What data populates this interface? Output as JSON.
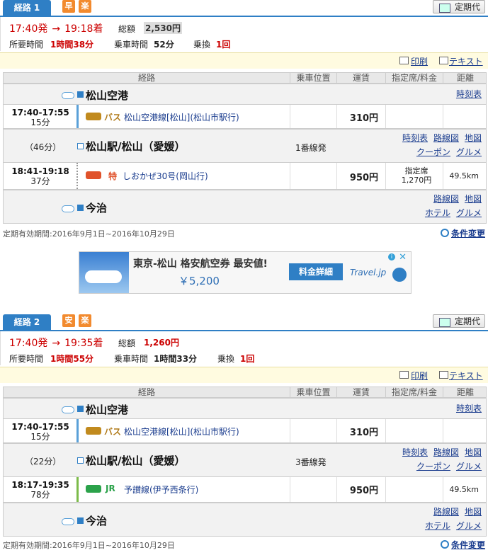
{
  "routes": [
    {
      "tab": "経路 1",
      "badges": [
        "早",
        "楽"
      ],
      "teiki": "定期代",
      "dep": "17:40発",
      "arr": "19:18着",
      "total_label": "総額",
      "total": "2,530円",
      "req_label": "所要時間",
      "req": "1時間38分",
      "ride_label": "乗車時間",
      "ride": "52分",
      "xfer_label": "乗換",
      "xfer": "1回",
      "print": "印刷",
      "text": "テキスト",
      "headers": [
        "経路",
        "乗車位置",
        "運賃",
        "指定席/料金",
        "距離"
      ],
      "stations": [
        {
          "name": "松山空港",
          "links": [
            "時刻表"
          ]
        },
        {
          "name": "松山駅/松山（愛媛）",
          "wait": "（46分）",
          "platform": "1番線発",
          "links": [
            "時刻表",
            "路線図",
            "地図",
            "クーポン",
            "グルメ"
          ]
        },
        {
          "name": "今治",
          "links": [
            "路線図",
            "地図",
            "ホテル",
            "グルメ"
          ]
        }
      ],
      "segments": [
        {
          "time": "17:40-17:55",
          "dur": "15分",
          "mode": "バス",
          "line": "松山空港線[松山](松山市駅行)",
          "fare": "310円",
          "resv": "",
          "resv2": "",
          "dist": ""
        },
        {
          "time": "18:41-19:18",
          "dur": "37分",
          "mode": "特",
          "line": "しおかぜ30号(岡山行)",
          "fare": "950円",
          "resv": "指定席",
          "resv2": "1,270円",
          "dist": "49.5km"
        }
      ],
      "validity": "定期有効期間:2016年9月1日~2016年10月29日",
      "cond": "条件変更"
    },
    {
      "tab": "経路 2",
      "badges": [
        "安",
        "楽"
      ],
      "teiki": "定期代",
      "dep": "17:40発",
      "arr": "19:35着",
      "total_label": "総額",
      "total": "1,260円",
      "req_label": "所要時間",
      "req": "1時間55分",
      "ride_label": "乗車時間",
      "ride": "1時間33分",
      "xfer_label": "乗換",
      "xfer": "1回",
      "print": "印刷",
      "text": "テキスト",
      "headers": [
        "経路",
        "乗車位置",
        "運賃",
        "指定席/料金",
        "距離"
      ],
      "stations": [
        {
          "name": "松山空港",
          "links": [
            "時刻表"
          ]
        },
        {
          "name": "松山駅/松山（愛媛）",
          "wait": "（22分）",
          "platform": "3番線発",
          "links": [
            "時刻表",
            "路線図",
            "地図",
            "クーポン",
            "グルメ"
          ]
        },
        {
          "name": "今治",
          "links": [
            "路線図",
            "地図",
            "ホテル",
            "グルメ"
          ]
        }
      ],
      "segments": [
        {
          "time": "17:40-17:55",
          "dur": "15分",
          "mode": "バス",
          "line": "松山空港線[松山](松山市駅行)",
          "fare": "310円",
          "resv": "",
          "resv2": "",
          "dist": ""
        },
        {
          "time": "18:17-19:35",
          "dur": "78分",
          "mode": "JR",
          "line": "予讃線(伊予西条行)",
          "fare": "950円",
          "resv": "",
          "resv2": "",
          "dist": "49.5km"
        }
      ],
      "validity": "定期有効期間:2016年9月1日~2016年10月29日",
      "cond": "条件変更"
    }
  ],
  "ad": {
    "headline": "東京-松山 格安航空券 最安値!",
    "price": "￥5,200",
    "button": "料金詳細",
    "brand": "Travel.jp",
    "close": "✕",
    "choice": "i"
  }
}
